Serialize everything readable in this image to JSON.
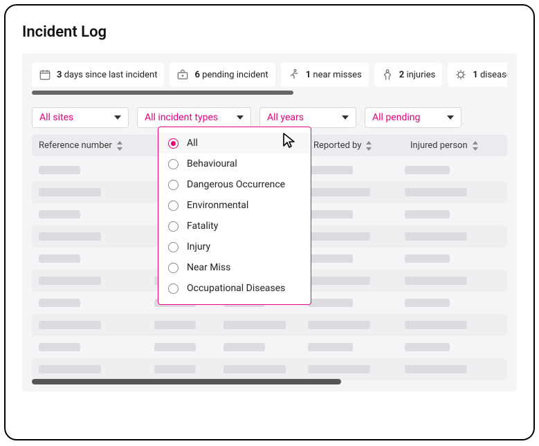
{
  "page": {
    "title": "Incident Log"
  },
  "stats": [
    {
      "count": "3",
      "label": "days since last incident"
    },
    {
      "count": "6",
      "label": "pending incident"
    },
    {
      "count": "1",
      "label": "near misses"
    },
    {
      "count": "2",
      "label": "injuries"
    },
    {
      "count": "1",
      "label": "diseases"
    }
  ],
  "filters": {
    "sites": "All sites",
    "incident_types": "All incident types",
    "years": "All years",
    "pending": "All pending"
  },
  "columns": {
    "reference": "Reference number",
    "reported_by": "Reported by",
    "injured_person": "Injured person"
  },
  "incident_type_dropdown": {
    "selected_index": 0,
    "options": [
      "All",
      "Behavioural",
      "Dangerous Occurrence",
      "Environmental",
      "Fatality",
      "Injury",
      "Near Miss",
      "Occupational Diseases"
    ]
  },
  "colors": {
    "accent": "#e6007e"
  }
}
